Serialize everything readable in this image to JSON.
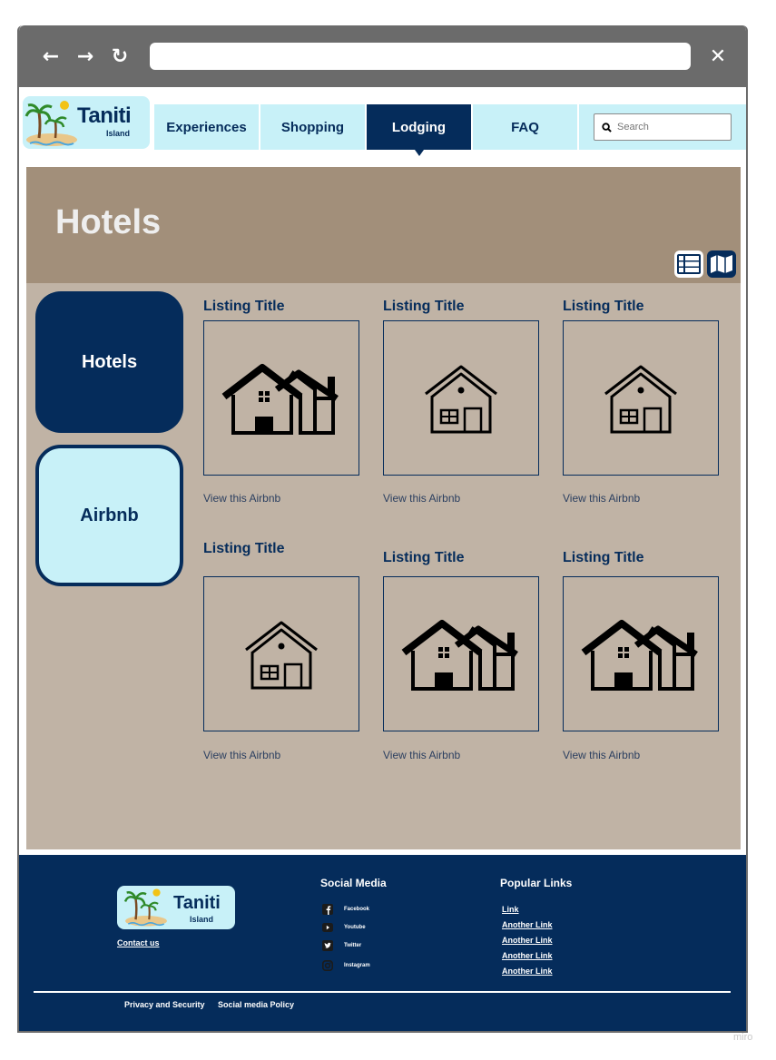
{
  "browser": {
    "back_icon": "←",
    "forward_icon": "→",
    "reload_icon": "↻",
    "close_icon": "✕",
    "address": ""
  },
  "logo": {
    "title": "Taniti",
    "subtitle": "Island"
  },
  "nav": {
    "tabs": [
      {
        "label": "Experiences",
        "active": false
      },
      {
        "label": "Shopping",
        "active": false
      },
      {
        "label": "Lodging",
        "active": true
      },
      {
        "label": "FAQ",
        "active": false
      }
    ],
    "search_placeholder": "Search"
  },
  "hero": {
    "title": "Hotels"
  },
  "sidebar": {
    "categories": [
      {
        "label": "Hotels",
        "selected": true
      },
      {
        "label": "Airbnb",
        "selected": false
      }
    ]
  },
  "listings": [
    {
      "title": "Listing Title",
      "link": "View this Airbnb",
      "icon": "houses-filled-icon"
    },
    {
      "title": "Listing Title",
      "link": "View this Airbnb",
      "icon": "house-outline-icon"
    },
    {
      "title": "Listing Title",
      "link": "View this Airbnb",
      "icon": "house-outline-icon"
    },
    {
      "title": "Listing Title",
      "link": "View this Airbnb",
      "icon": "house-outline-icon"
    },
    {
      "title": "Listing Title",
      "link": "View this Airbnb",
      "icon": "houses-filled-icon"
    },
    {
      "title": "Listing Title",
      "link": "View this Airbnb",
      "icon": "houses-filled-icon"
    }
  ],
  "footer": {
    "logo_title": "Taniti",
    "logo_subtitle": "Island",
    "contact": "Contact us",
    "social_heading": "Social Media",
    "social": [
      "Facebook",
      "Youtube",
      "Twitter",
      "Instagram"
    ],
    "links_heading": "Popular Links",
    "links": [
      "Link",
      "Another Link",
      "Another Link",
      "Another Link",
      "Another Link"
    ],
    "privacy": "Privacy and Security",
    "social_policy": "Social media Policy"
  },
  "watermark": "miro",
  "colors": {
    "navy": "#052c5b",
    "light_cyan": "#c8f1f8",
    "hero_brown": "#a28f7a",
    "content_tan": "#c0b3a5",
    "chrome_gray": "#6b6b6b"
  }
}
